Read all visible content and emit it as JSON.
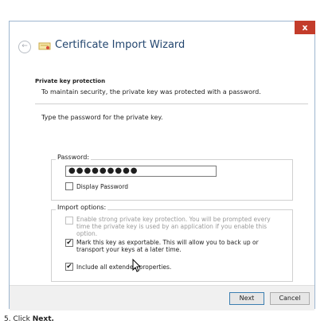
{
  "window": {
    "title": "Certificate Import Wizard",
    "close_glyph": "x"
  },
  "header": {
    "back_glyph": "←"
  },
  "section": {
    "heading": "Private key protection",
    "description": "To maintain security, the private key was protected with a password."
  },
  "instruction": "Type the password for the private key.",
  "password": {
    "label": "Password:",
    "value": "●●●●●●●●●",
    "display_label": "Display Password",
    "display_checked": false
  },
  "import_options": {
    "title": "Import options:",
    "options": [
      {
        "label": "Enable strong private key protection. You will be prompted every time the private key is used by an application if you enable this option.",
        "checked": false,
        "enabled": false
      },
      {
        "label": "Mark this key as exportable. This will allow you to back up or transport your keys at a later time.",
        "checked": true,
        "enabled": true
      },
      {
        "label": "Include all extended properties.",
        "checked": true,
        "enabled": true
      }
    ]
  },
  "buttons": {
    "next": "Next",
    "cancel": "Cancel"
  },
  "caption": {
    "prefix": "5. Click ",
    "bold": "Next."
  },
  "colors": {
    "title": "#23466f",
    "close_button": "#c33c2b",
    "frame": "#cfe0ef"
  }
}
